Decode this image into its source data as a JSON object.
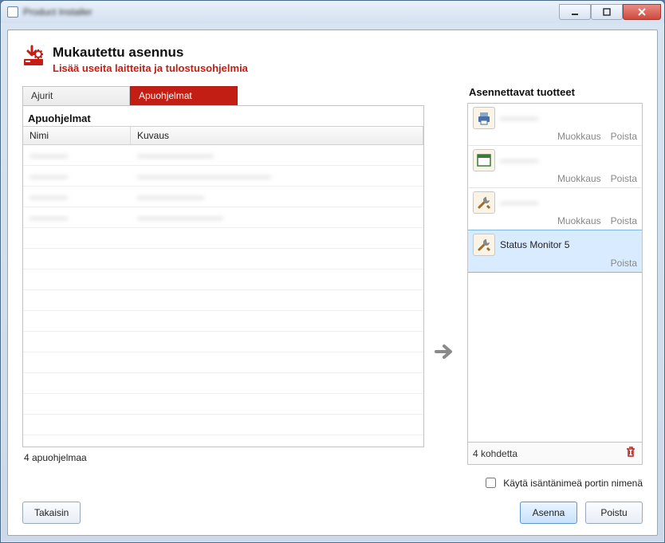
{
  "window": {
    "title": "Product Installer"
  },
  "header": {
    "title": "Mukautettu asennus",
    "subtitle": "Lisää useita laitteita ja tulostusohjelmia"
  },
  "tabs": {
    "drivers": "Ajurit",
    "utilities": "Apuohjelmat"
  },
  "panel": {
    "title": "Apuohjelmat",
    "col_name": "Nimi",
    "col_desc": "Kuvaus",
    "rows": [
      {
        "name": "————",
        "desc": "————————"
      },
      {
        "name": "————",
        "desc": "——————————————"
      },
      {
        "name": "————",
        "desc": "———————"
      },
      {
        "name": "————",
        "desc": "—————————"
      }
    ],
    "footer": "4 apuohjelmaa"
  },
  "right": {
    "title": "Asennettavat tuotteet",
    "products": [
      {
        "icon": "printer",
        "name": "————",
        "blurred": true,
        "edit": "Muokkaus",
        "remove": "Poista",
        "selected": false
      },
      {
        "icon": "window",
        "name": "————",
        "blurred": true,
        "edit": "Muokkaus",
        "remove": "Poista",
        "selected": false
      },
      {
        "icon": "tools",
        "name": "————",
        "blurred": true,
        "edit": "Muokkaus",
        "remove": "Poista",
        "selected": false
      },
      {
        "icon": "tools",
        "name": "Status Monitor 5",
        "blurred": false,
        "edit": "",
        "remove": "Poista",
        "selected": true
      }
    ],
    "footer_count": "4 kohdetta"
  },
  "checkbox": {
    "label": "Käytä isäntänimeä portin nimenä"
  },
  "buttons": {
    "back": "Takaisin",
    "install": "Asenna",
    "exit": "Poistu"
  }
}
